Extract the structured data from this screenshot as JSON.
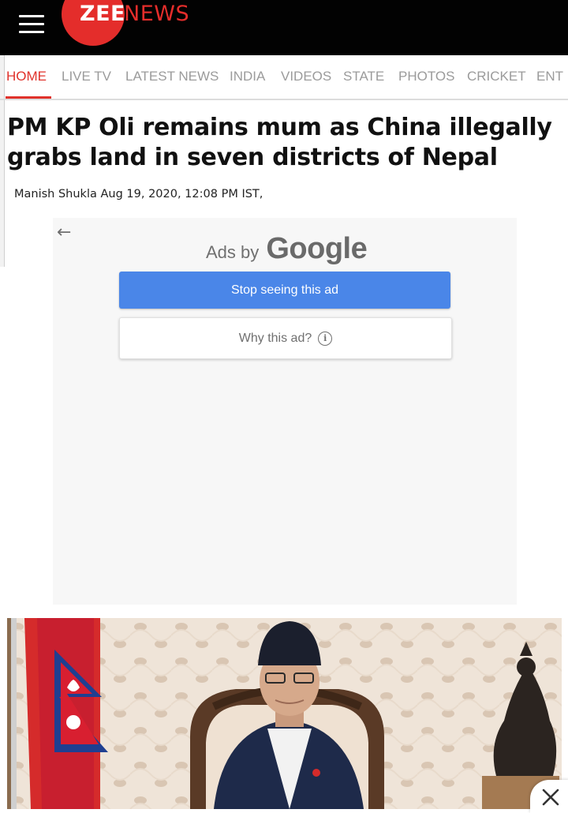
{
  "header": {
    "logo_zee": "ZEE",
    "logo_news": "NEWS"
  },
  "nav": {
    "items": [
      {
        "label": "HOME",
        "active": true
      },
      {
        "label": "LIVE TV"
      },
      {
        "label": "LATEST NEWS"
      },
      {
        "label": "INDIA"
      },
      {
        "label": "VIDEOS"
      },
      {
        "label": "STATE"
      },
      {
        "label": "PHOTOS"
      },
      {
        "label": "CRICKET"
      },
      {
        "label": "ENT"
      }
    ]
  },
  "article": {
    "headline": "PM KP Oli remains mum as China illegally grabs land in seven districts of Nepal",
    "byline": "Manish Shukla Aug 19, 2020, 12:08 PM IST,"
  },
  "ad": {
    "ads_by": "Ads by",
    "google": "Google",
    "stop_label": "Stop seeing this ad",
    "why_label": "Why this ad?"
  },
  "colors": {
    "brand_red": "#e42d2b",
    "header_bg": "#020202",
    "ad_button_blue": "#4a86e8"
  },
  "icons": [
    "menu-icon",
    "back-arrow-icon",
    "info-icon",
    "close-icon"
  ]
}
